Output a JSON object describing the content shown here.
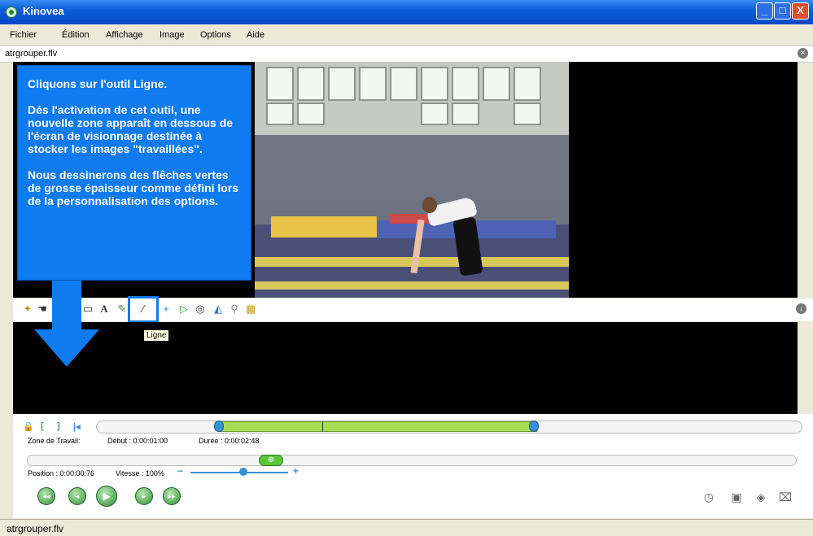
{
  "window": {
    "title": "Kinovea",
    "min_label": "_",
    "max_label": "□",
    "close_label": "X"
  },
  "menu": [
    "Fichier",
    "Édition",
    "Affichage",
    "Image",
    "Options",
    "Aide"
  ],
  "file_tab": {
    "name": "atrgrouper.flv",
    "close_label": "×"
  },
  "info_box": {
    "p1": "Cliquons sur l'outil Ligne.",
    "p2": "Dés l'activation de cet outil, une nouvelle zone apparaît en dessous de l'écran de visionnage destinée à  stocker les images \"travaillées\".",
    "p3": "Nous dessinerons des flêches vertes de grosse épaisseur comme défini lors de la personnalisation des options."
  },
  "toolbar": {
    "icons": [
      "key-image-icon",
      "hand-icon",
      "pencil-icon",
      "text-icon",
      "marker-icon",
      "line-icon",
      "cross-icon",
      "angle-icon",
      "circle-icon",
      "grid-icon",
      "magnifier-icon",
      "color-palette-icon"
    ],
    "tooltip": "Ligne",
    "expand_label": "↓"
  },
  "timeline": {
    "zone_label": "Zone de Travail:",
    "debut": "Début : 0:00:01:00",
    "duree": "Durée : 0:00:02:48",
    "position": "Position : 0:00:00:76",
    "vitesse": "Vitesse : 100%",
    "speed_minus": "−",
    "speed_plus": "+",
    "work_start_fraction": 0.16,
    "work_end_fraction": 0.6,
    "position_fraction": 0.3,
    "speed_fraction": 0.5
  },
  "playback": {
    "buttons": [
      "first-frame-icon",
      "previous-frame-icon",
      "play-icon",
      "next-frame-icon",
      "last-frame-icon"
    ],
    "right_icons": [
      "sync-icon",
      "snapshot-icon",
      "video-export-icon",
      "presentation-icon"
    ]
  },
  "status": {
    "text": "atrgrouper.flv"
  },
  "colors": {
    "accent": "#0e7bf0",
    "selection": "#a9dd55",
    "play": "#2f8f3a"
  }
}
